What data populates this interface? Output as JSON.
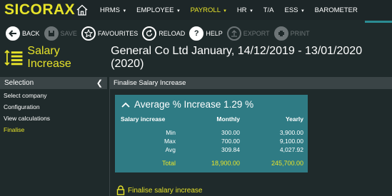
{
  "app": {
    "logo": "SICORAX"
  },
  "nav": {
    "items": [
      {
        "label": "HRMS",
        "caret": "▾"
      },
      {
        "label": "EMPLOYEE",
        "caret": "▾"
      },
      {
        "label": "PAYROLL",
        "caret": "▾"
      },
      {
        "label": "HR",
        "caret": "▾"
      },
      {
        "label": "T/A",
        "caret": ""
      },
      {
        "label": "ESS",
        "caret": "▾"
      },
      {
        "label": "BAROMETER",
        "caret": ""
      }
    ],
    "active": "PAYROLL",
    "colors": {
      "accent": "#e7e32a",
      "teal": "#2b8c93"
    }
  },
  "toolbar": {
    "back": "BACK",
    "save": "SAVE",
    "favourites": "FAVOURITES",
    "reload": "RELOAD",
    "help": "HELP",
    "export": "EXPORT",
    "print": "PRINT"
  },
  "title": {
    "main": "Salary Increase",
    "sub": "General Co Ltd January, 14/12/2019 - 13/01/2020 (2020)"
  },
  "sidebar": {
    "header": "Selection",
    "items": [
      {
        "label": "Select company"
      },
      {
        "label": "Configuration"
      },
      {
        "label": "View calculations"
      },
      {
        "label": "Finalise"
      }
    ]
  },
  "main": {
    "header": "Finalise Salary Increase",
    "card": {
      "title": "Average % Increase 1.29 %",
      "col_label": "Salary increase",
      "col_monthly": "Monthly",
      "col_yearly": "Yearly",
      "rows": [
        {
          "label": "Min",
          "monthly": "300.00",
          "yearly": "3,900.00"
        },
        {
          "label": "Max",
          "monthly": "700.00",
          "yearly": "9,100.00"
        },
        {
          "label": "Avg",
          "monthly": "309.84",
          "yearly": "4,027.92"
        }
      ],
      "total": {
        "label": "Total",
        "monthly": "18,900.00",
        "yearly": "245,700.00"
      }
    },
    "finalise_label": "Finalise salary increase"
  }
}
